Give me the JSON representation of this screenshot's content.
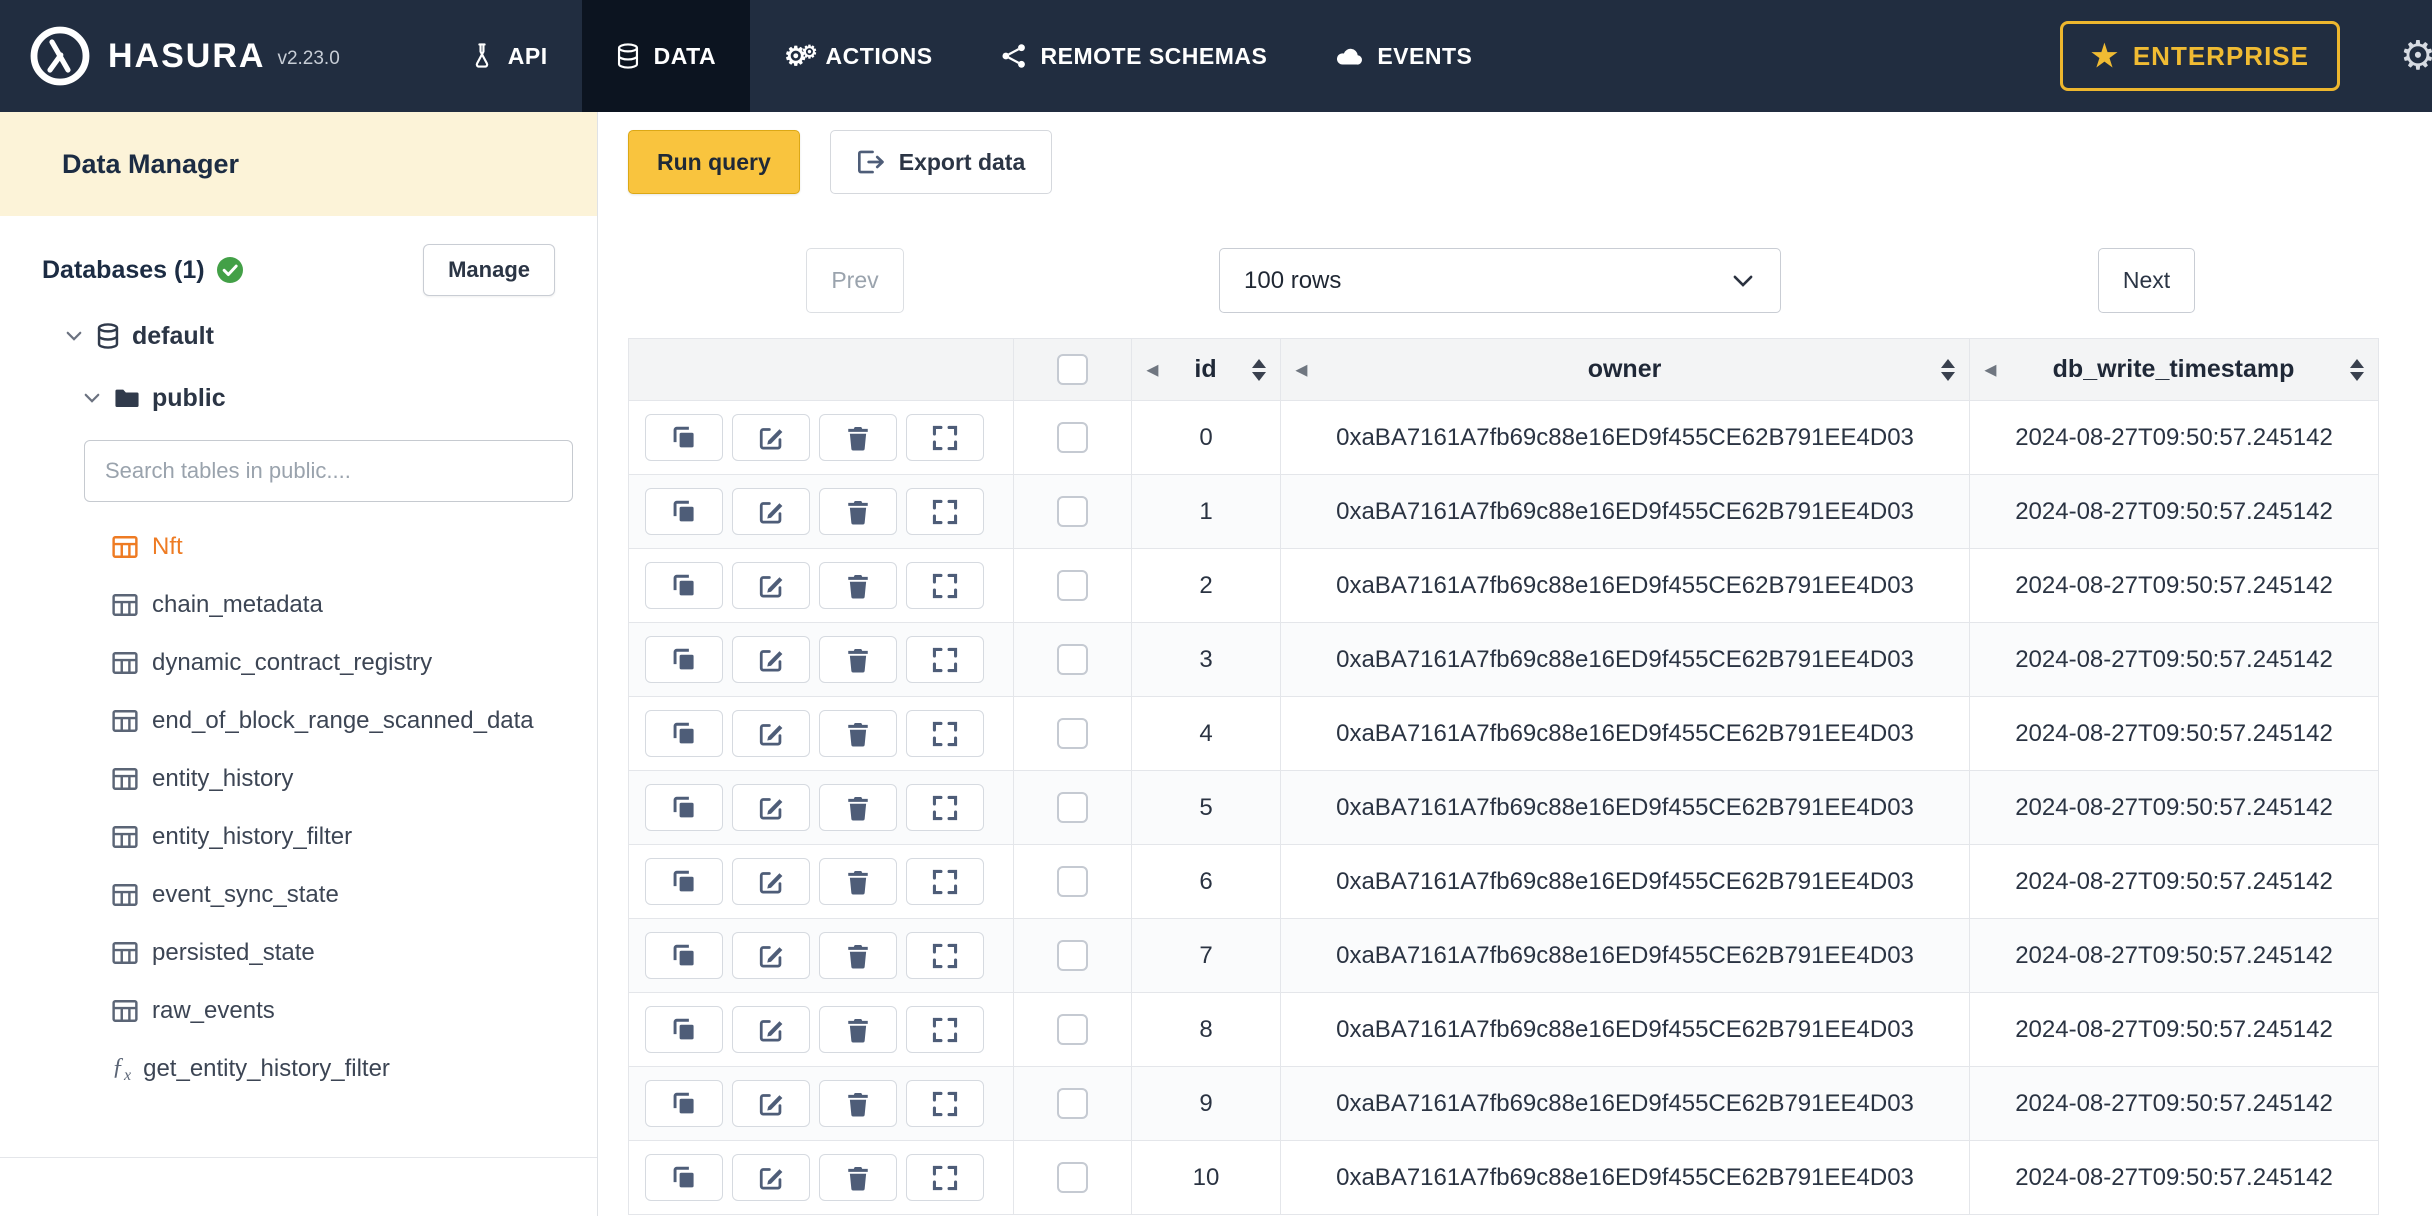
{
  "navbar": {
    "brand": "HASURA",
    "version": "v2.23.0",
    "items": [
      {
        "label": "API",
        "icon": "flask-icon"
      },
      {
        "label": "DATA",
        "icon": "database-icon",
        "active": true
      },
      {
        "label": "ACTIONS",
        "icon": "gears-icon"
      },
      {
        "label": "REMOTE SCHEMAS",
        "icon": "share-nodes-icon"
      },
      {
        "label": "EVENTS",
        "icon": "cloud-icon"
      }
    ],
    "enterprise_label": "ENTERPRISE"
  },
  "sidebar": {
    "title": "Data Manager",
    "databases_label": "Databases (1)",
    "manage_button": "Manage",
    "tree": {
      "database": "default",
      "schema": "public"
    },
    "search_placeholder": "Search tables in public....",
    "tables": [
      {
        "label": "Nft",
        "highlighted": true
      },
      {
        "label": "chain_metadata"
      },
      {
        "label": "dynamic_contract_registry"
      },
      {
        "label": "end_of_block_range_scanned_data"
      },
      {
        "label": "entity_history"
      },
      {
        "label": "entity_history_filter"
      },
      {
        "label": "event_sync_state"
      },
      {
        "label": "persisted_state"
      },
      {
        "label": "raw_events"
      }
    ],
    "functions": [
      {
        "label": "get_entity_history_filter"
      }
    ]
  },
  "toolbar": {
    "run_query_label": "Run query",
    "export_data_label": "Export data"
  },
  "pagination": {
    "prev_label": "Prev",
    "rows_value": "100 rows",
    "next_label": "Next"
  },
  "grid": {
    "columns": {
      "id": "id",
      "owner": "owner",
      "timestamp": "db_write_timestamp"
    },
    "rows": [
      {
        "id": "0",
        "owner": "0xaBA7161A7fb69c88e16ED9f455CE62B791EE4D03",
        "db_write_timestamp": "2024-08-27T09:50:57.245142"
      },
      {
        "id": "1",
        "owner": "0xaBA7161A7fb69c88e16ED9f455CE62B791EE4D03",
        "db_write_timestamp": "2024-08-27T09:50:57.245142"
      },
      {
        "id": "2",
        "owner": "0xaBA7161A7fb69c88e16ED9f455CE62B791EE4D03",
        "db_write_timestamp": "2024-08-27T09:50:57.245142"
      },
      {
        "id": "3",
        "owner": "0xaBA7161A7fb69c88e16ED9f455CE62B791EE4D03",
        "db_write_timestamp": "2024-08-27T09:50:57.245142"
      },
      {
        "id": "4",
        "owner": "0xaBA7161A7fb69c88e16ED9f455CE62B791EE4D03",
        "db_write_timestamp": "2024-08-27T09:50:57.245142"
      },
      {
        "id": "5",
        "owner": "0xaBA7161A7fb69c88e16ED9f455CE62B791EE4D03",
        "db_write_timestamp": "2024-08-27T09:50:57.245142"
      },
      {
        "id": "6",
        "owner": "0xaBA7161A7fb69c88e16ED9f455CE62B791EE4D03",
        "db_write_timestamp": "2024-08-27T09:50:57.245142"
      },
      {
        "id": "7",
        "owner": "0xaBA7161A7fb69c88e16ED9f455CE62B791EE4D03",
        "db_write_timestamp": "2024-08-27T09:50:57.245142"
      },
      {
        "id": "8",
        "owner": "0xaBA7161A7fb69c88e16ED9f455CE62B791EE4D03",
        "db_write_timestamp": "2024-08-27T09:50:57.245142"
      },
      {
        "id": "9",
        "owner": "0xaBA7161A7fb69c88e16ED9f455CE62B791EE4D03",
        "db_write_timestamp": "2024-08-27T09:50:57.245142"
      },
      {
        "id": "10",
        "owner": "0xaBA7161A7fb69c88e16ED9f455CE62B791EE4D03",
        "db_write_timestamp": "2024-08-27T09:50:57.245142"
      }
    ]
  },
  "colors": {
    "navbar_bg": "#212d40",
    "accent_gold": "#f9c43e",
    "brand_navy": "#1f2c43",
    "highlight_orange": "#ee7b23",
    "success_green": "#43a047",
    "icon_slate": "#4e5d78"
  }
}
